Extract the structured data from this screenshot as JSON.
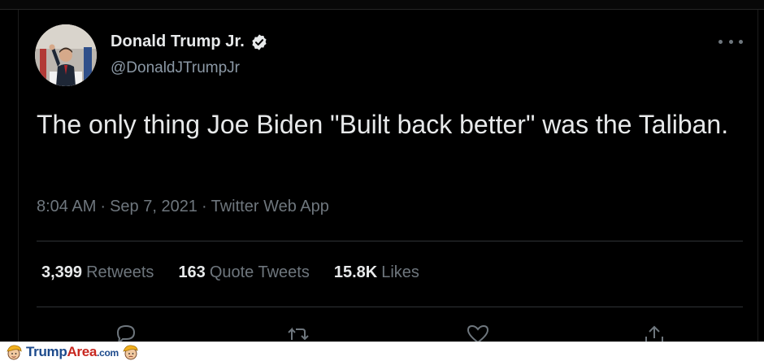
{
  "tweet": {
    "author_name": "Donald Trump Jr.",
    "handle": "@DonaldJTrumpJr",
    "text": "The only thing Joe Biden \"Built back better\" was the Taliban.",
    "time": "8:04 AM",
    "date": "Sep 7, 2021",
    "source": "Twitter Web App",
    "separator": "·"
  },
  "stats": {
    "retweets_count": "3,399",
    "retweets_label": "Retweets",
    "quotes_count": "163",
    "quotes_label": "Quote Tweets",
    "likes_count": "15.8K",
    "likes_label": "Likes"
  },
  "icons": {
    "verified": "verified-badge-icon",
    "more": "more-options-icon",
    "reply": "reply-icon",
    "retweet": "retweet-icon",
    "like": "heart-icon",
    "share": "share-icon"
  },
  "footer": {
    "brand_part1": "Trump",
    "brand_part2": "Area",
    "brand_suffix": ".com"
  },
  "colors": {
    "background": "#000000",
    "text_primary": "#e7e9ea",
    "text_secondary": "#6e767d",
    "divider": "#2f3336",
    "footer_blue": "#1c4a8c",
    "footer_red": "#c8271f"
  }
}
